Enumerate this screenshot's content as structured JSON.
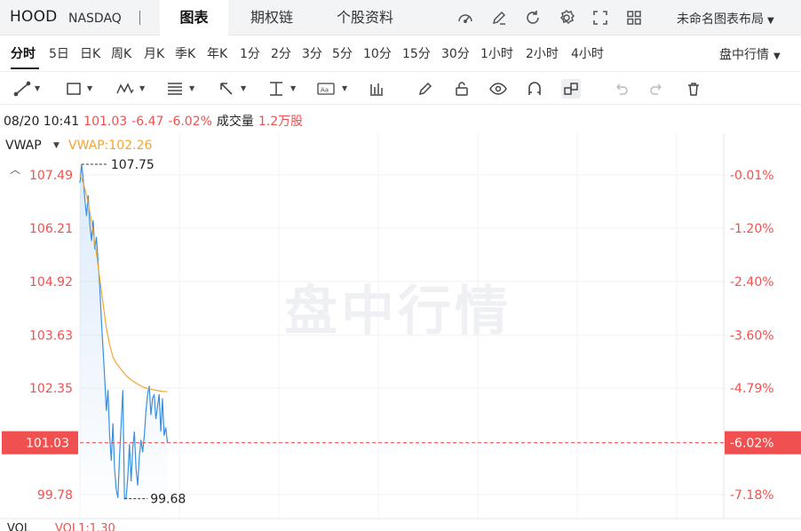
{
  "header": {
    "ticker": "HOOD",
    "exchange": "NASDAQ",
    "tabs": [
      "图表",
      "期权链",
      "个股资料"
    ],
    "active_tab": "图表",
    "layout_label": "未命名图表布局",
    "icons": [
      "gauge-icon",
      "edit-icon",
      "refresh-icon",
      "settings-icon",
      "fullscreen-icon",
      "grid-icon"
    ]
  },
  "periods": {
    "items": [
      "分时",
      "5日",
      "日K",
      "周K",
      "月K",
      "季K",
      "年K",
      "1分",
      "2分",
      "3分",
      "5分",
      "10分",
      "15分",
      "30分",
      "1小时",
      "2小时",
      "4小时"
    ],
    "active": "分时",
    "session_label": "盘中行情"
  },
  "toolbar": {
    "tools": [
      "line-tool-icon",
      "rectangle-tool-icon",
      "pattern-tool-icon",
      "fib-tool-icon",
      "arrow-tool-icon",
      "measure-tool-icon",
      "text-tool-icon",
      "indicator-tool-icon",
      "pencil-icon",
      "lock-icon",
      "eye-icon",
      "magnet-icon",
      "link-icon",
      "undo-icon",
      "redo-icon",
      "delete-icon"
    ]
  },
  "info": {
    "datetime": "08/20 10:41",
    "price": "101.03",
    "change": "-6.47",
    "change_pct": "-6.02%",
    "volume_label": "成交量",
    "volume": "1.2万股"
  },
  "indicator": {
    "name": "VWAP",
    "value_text": "VWAP:102.26",
    "vol_name": "VOL",
    "vol_value": "VOL1:1.30"
  },
  "watermark": "盘中行情",
  "colors": {
    "price_line": "#3a8fe0",
    "vwap_line": "#f3a531",
    "down": "#f0504f",
    "current_bg": "#f0504f"
  },
  "chart_data": {
    "type": "line",
    "y_ticks": [
      "107.49",
      "106.21",
      "104.92",
      "103.63",
      "102.35",
      "101.03",
      "99.78"
    ],
    "y_tick_values": [
      107.49,
      106.21,
      104.92,
      103.63,
      102.35,
      101.03,
      99.78
    ],
    "pct_ticks": [
      "-0.01%",
      "-1.20%",
      "-2.40%",
      "-3.60%",
      "-4.79%",
      "-6.02%",
      "-7.18%"
    ],
    "y_range": [
      99.2,
      108.5
    ],
    "x_range": [
      0,
      390
    ],
    "high": {
      "label": "107.75",
      "value": 107.75,
      "x": 1
    },
    "low": {
      "label": "99.68",
      "value": 99.68,
      "x": 27
    },
    "current": {
      "label": "101.03",
      "pct_label": "-6.02%",
      "value": 101.03
    },
    "series": [
      {
        "role": "price",
        "x": [
          0,
          1,
          2,
          3,
          4,
          5,
          6,
          7,
          8,
          9,
          10,
          11,
          12,
          13,
          14,
          15,
          16,
          17,
          18,
          19,
          20,
          21,
          22,
          23,
          24,
          25,
          26,
          27,
          28,
          29,
          30,
          31,
          32,
          33,
          34,
          35,
          36,
          37,
          38,
          39,
          40,
          41,
          42,
          43,
          44,
          45,
          46,
          47,
          48,
          49,
          50,
          51,
          52,
          53
        ],
        "y": [
          107.3,
          107.75,
          107.4,
          106.9,
          106.5,
          107.0,
          106.3,
          105.9,
          106.4,
          105.7,
          106.0,
          105.4,
          104.8,
          104.0,
          103.3,
          102.6,
          101.8,
          102.3,
          101.2,
          100.6,
          101.5,
          100.4,
          99.9,
          99.7,
          100.7,
          101.5,
          102.3,
          99.68,
          99.7,
          100.2,
          101.0,
          100.1,
          100.9,
          101.3,
          100.4,
          100.0,
          100.7,
          101.1,
          100.8,
          101.2,
          101.8,
          102.2,
          102.4,
          101.7,
          102.1,
          102.2,
          101.6,
          101.9,
          102.2,
          101.3,
          102.1,
          101.2,
          101.4,
          101.03
        ]
      },
      {
        "role": "vwap",
        "x": [
          0,
          2,
          4,
          6,
          8,
          10,
          12,
          14,
          16,
          18,
          20,
          22,
          24,
          26,
          28,
          30,
          32,
          34,
          36,
          38,
          40,
          42,
          44,
          46,
          48,
          50,
          53
        ],
        "y": [
          107.5,
          107.3,
          107.0,
          106.6,
          106.1,
          105.6,
          105.0,
          104.4,
          103.8,
          103.4,
          103.1,
          102.95,
          102.85,
          102.75,
          102.65,
          102.58,
          102.52,
          102.47,
          102.42,
          102.38,
          102.35,
          102.33,
          102.31,
          102.3,
          102.28,
          102.27,
          102.26
        ]
      }
    ]
  }
}
